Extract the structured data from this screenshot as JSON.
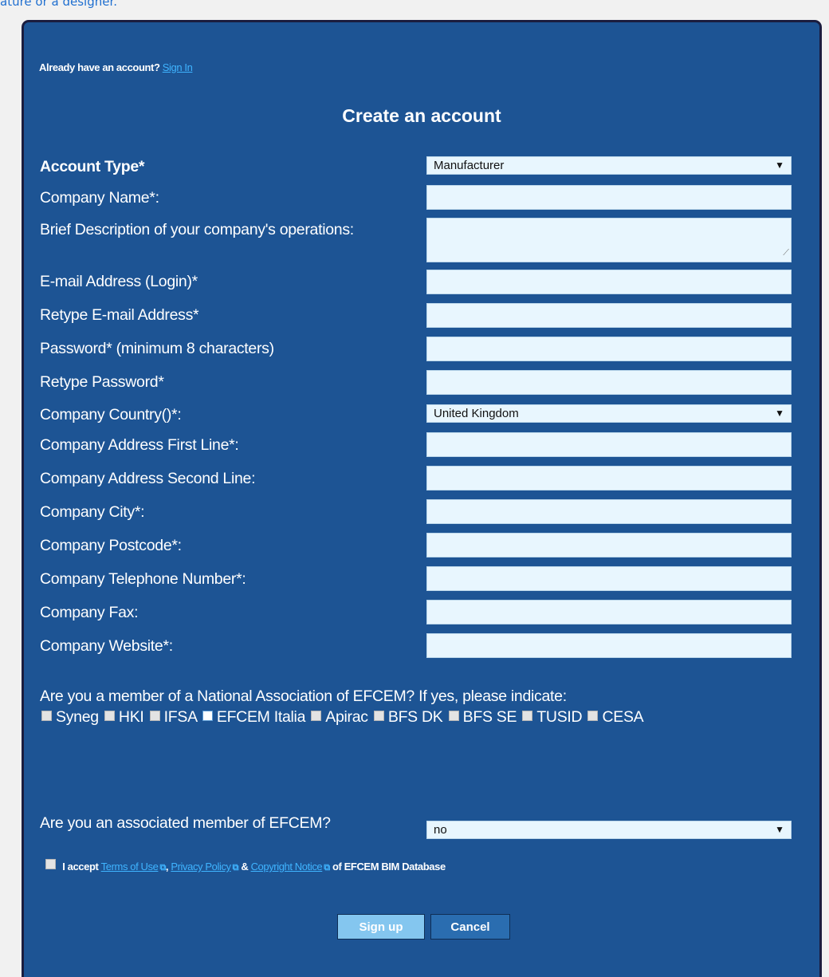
{
  "top_snippet": "ature or a designer.",
  "signin": {
    "prompt": "Already have an account?",
    "link": "Sign In"
  },
  "title": "Create an account",
  "account_type": {
    "label": "Account Type*",
    "value": "Manufacturer"
  },
  "company_name": {
    "label": "Company Name*:",
    "value": ""
  },
  "description": {
    "label": "Brief Description of your company's operations:",
    "value": ""
  },
  "email": {
    "label": "E-mail Address (Login)*",
    "value": ""
  },
  "email_retype": {
    "label": "Retype E-mail Address*",
    "value": ""
  },
  "password": {
    "label": "Password* (minimum 8 characters)",
    "value": ""
  },
  "password_retype": {
    "label": "Retype Password*",
    "value": ""
  },
  "country": {
    "label": "Company Country()*:",
    "value": "United Kingdom"
  },
  "address1": {
    "label": "Company Address First Line*:",
    "value": ""
  },
  "address2": {
    "label": "Company Address Second Line:",
    "value": ""
  },
  "city": {
    "label": "Company City*:",
    "value": ""
  },
  "postcode": {
    "label": "Company Postcode*:",
    "value": ""
  },
  "telephone": {
    "label": "Company Telephone Number*:",
    "value": ""
  },
  "fax": {
    "label": "Company Fax:",
    "value": ""
  },
  "website": {
    "label": "Company Website*:",
    "value": ""
  },
  "membership": {
    "question": "Are you a member of a National Association of EFCEM? If yes, please indicate:",
    "options": [
      "Syneg",
      "HKI",
      "IFSA",
      "EFCEM Italia",
      "Apirac",
      "BFS DK",
      "BFS SE",
      "TUSID",
      "CESA"
    ]
  },
  "associated": {
    "label": "Are you an associated member of EFCEM?",
    "value": "no"
  },
  "terms": {
    "prefix": "I accept",
    "terms_link": "Terms of Use",
    "sep1": ",",
    "privacy_link": "Privacy Policy",
    "sep2": "&",
    "copyright_link": "Copyright Notice",
    "suffix": "of EFCEM BIM Database"
  },
  "buttons": {
    "signup": "Sign up",
    "cancel": "Cancel"
  },
  "icons": {
    "dropdown": "triangle-down-icon",
    "external": "external-link-icon"
  }
}
